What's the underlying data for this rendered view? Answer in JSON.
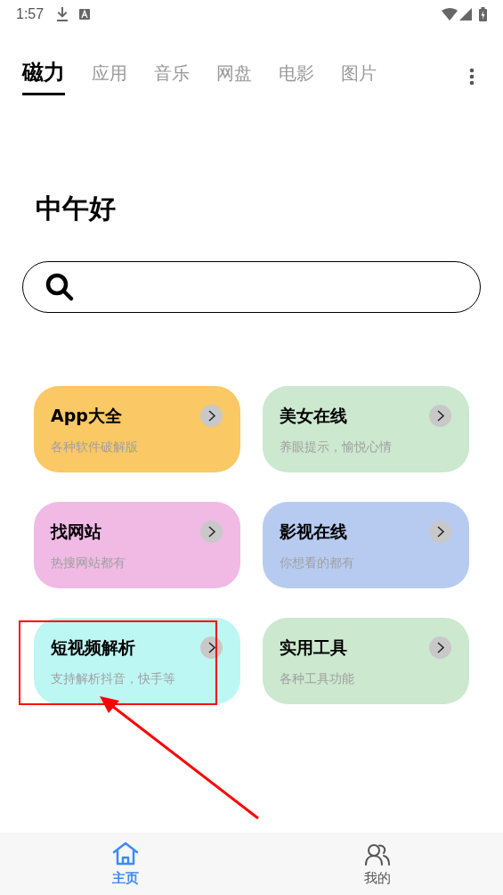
{
  "status_bar": {
    "time": "1:57"
  },
  "tabs": [
    {
      "label": "磁力",
      "selected": true
    },
    {
      "label": "应用",
      "selected": false
    },
    {
      "label": "音乐",
      "selected": false
    },
    {
      "label": "网盘",
      "selected": false
    },
    {
      "label": "电影",
      "selected": false
    },
    {
      "label": "图片",
      "selected": false
    }
  ],
  "greeting": "中午好",
  "cards": [
    {
      "title": "App大全",
      "subtitle": "各种软件破解版",
      "color": "#fac864"
    },
    {
      "title": "美女在线",
      "subtitle": "养眼提示，愉悦心情",
      "color": "#cce8cf"
    },
    {
      "title": "找网站",
      "subtitle": "热搜网站都有",
      "color": "#f0bae5"
    },
    {
      "title": "影视在线",
      "subtitle": "你想看的都有",
      "color": "#b7cbf0"
    },
    {
      "title": "短视频解析",
      "subtitle": "支持解析抖音，快手等",
      "color": "#bdf7f4"
    },
    {
      "title": "实用工具",
      "subtitle": "各种工具功能",
      "color": "#cce8cf"
    }
  ],
  "bottom_nav": [
    {
      "label": "主页",
      "kind": "home",
      "selected": true
    },
    {
      "label": "我的",
      "kind": "people",
      "selected": false
    }
  ]
}
